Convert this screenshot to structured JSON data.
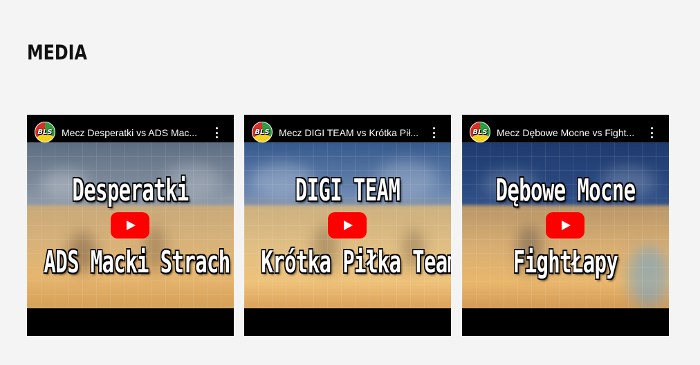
{
  "section": {
    "title": "MEDIA"
  },
  "videos": [
    {
      "channel_logo_text": "BLS",
      "title": "Mecz Desperatki vs ADS Mac...",
      "team_a": "Desperatki",
      "team_b": "ADS Macki Strach"
    },
    {
      "channel_logo_text": "BLS",
      "title": "Mecz DIGI TEAM vs Krótka Pił...",
      "team_a": "DIGI TEAM",
      "team_b": "Krótka Piłka Team"
    },
    {
      "channel_logo_text": "BLS",
      "title": "Mecz Dębowe Mocne vs Fight...",
      "team_a": "Dębowe Mocne",
      "team_b": "FightŁapy"
    }
  ],
  "icons": {
    "play": "youtube-play-icon",
    "more": "more-vert-icon"
  },
  "colors": {
    "page_background": "#f4f4f4",
    "play_button": "#ff0000",
    "player_bar": "#000000"
  }
}
